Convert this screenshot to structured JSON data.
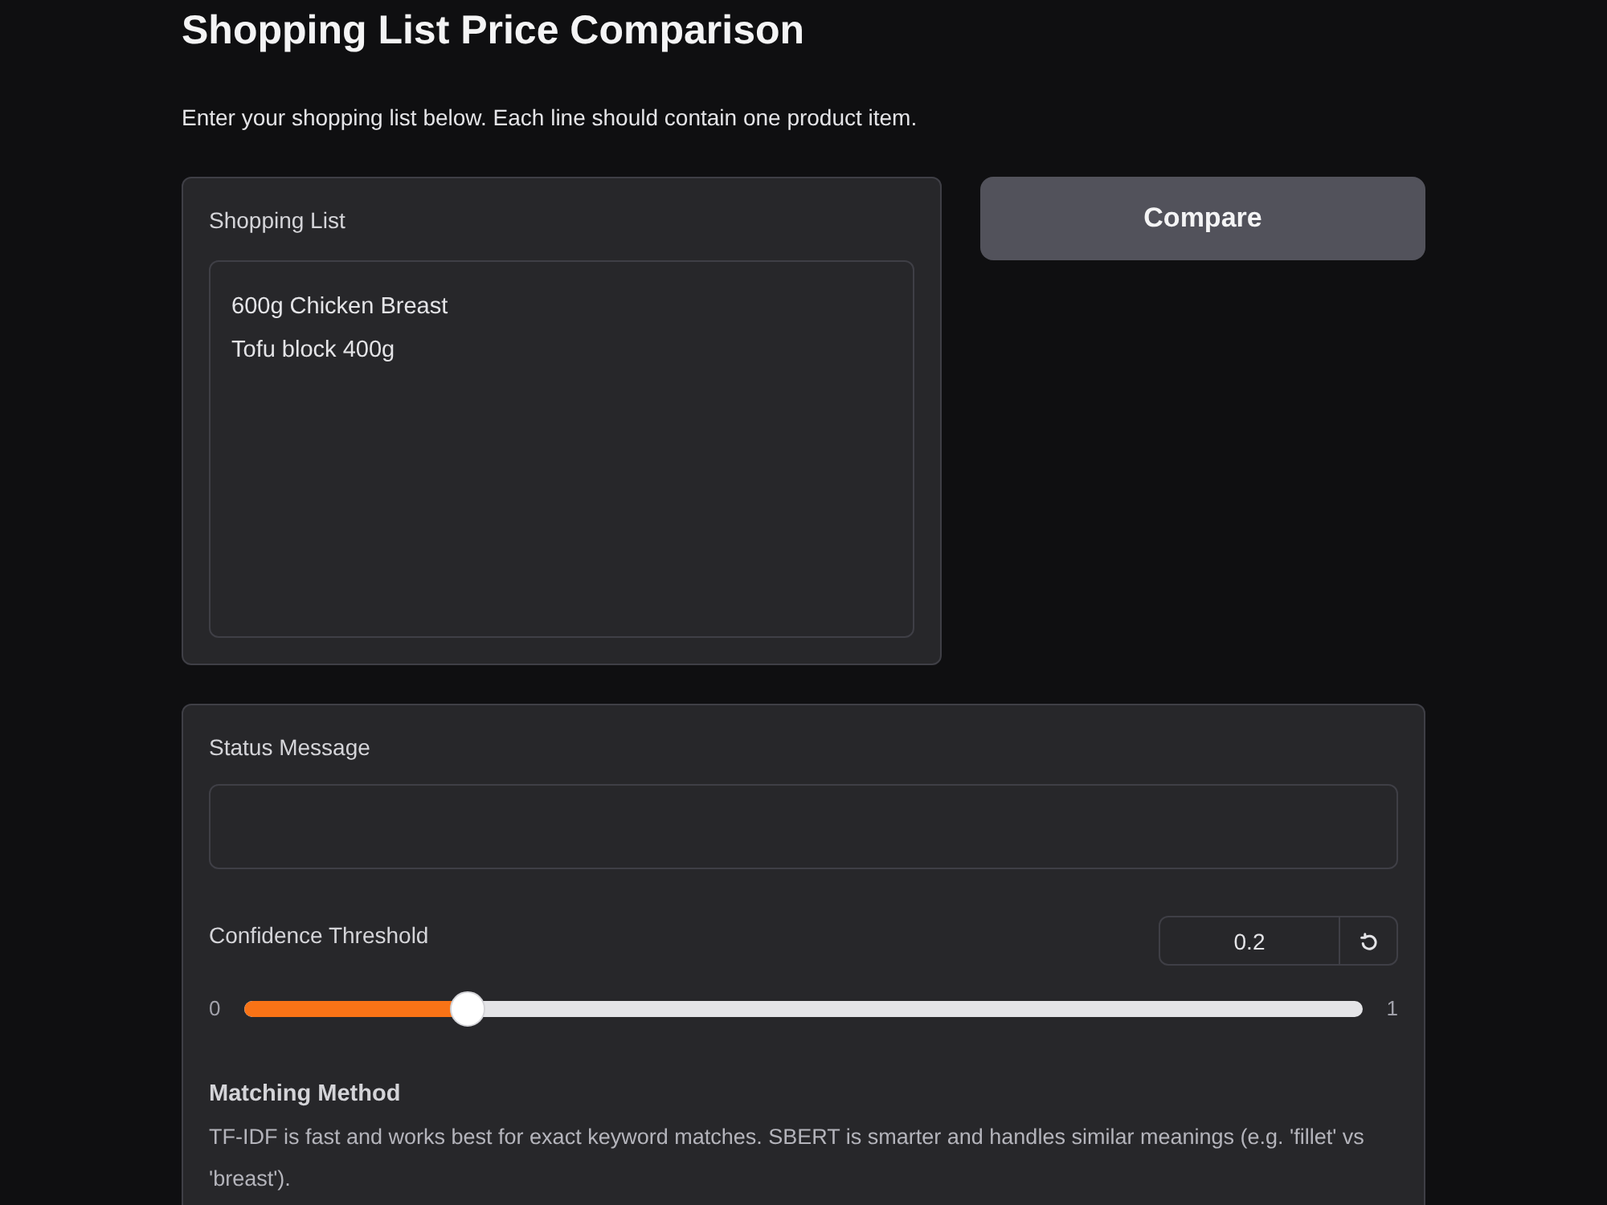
{
  "page": {
    "title": "Shopping List Price Comparison",
    "description": "Enter your shopping list below. Each line should contain one product item."
  },
  "shopping_list": {
    "label": "Shopping List",
    "value": "600g Chicken Breast\nTofu block 400g"
  },
  "compare_button": {
    "label": "Compare"
  },
  "status_message": {
    "label": "Status Message"
  },
  "confidence_threshold": {
    "label": "Confidence Threshold",
    "value": "0.2",
    "min_label": "0",
    "max_label": "1",
    "level": 0.2
  },
  "matching_method": {
    "label": "Matching Method",
    "info": "TF-IDF is fast and works best for exact keyword matches. SBERT is smarter and handles similar meanings (e.g. 'fillet' vs 'breast')."
  }
}
